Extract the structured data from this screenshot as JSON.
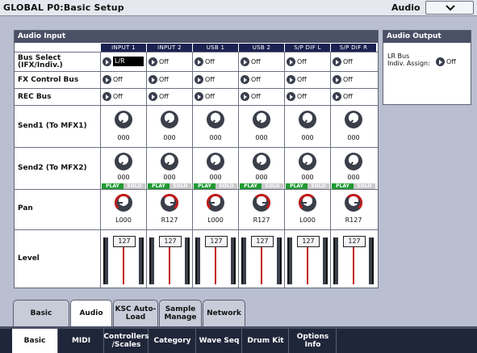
{
  "header": {
    "title": "GLOBAL P0:Basic Setup",
    "page": "Audio"
  },
  "audio_input": {
    "title": "Audio Input",
    "columns": [
      "INPUT 1",
      "INPUT 2",
      "USB 1",
      "USB 2",
      "S/P DIF L",
      "S/P DIF R"
    ],
    "rows": {
      "bus_select": {
        "label1": "Bus Select",
        "label2": "(IFX/Indiv.)",
        "values": [
          "L/R",
          "Off",
          "Off",
          "Off",
          "Off",
          "Off"
        ]
      },
      "fx_control": {
        "label": "FX Control Bus",
        "values": [
          "Off",
          "Off",
          "Off",
          "Off",
          "Off",
          "Off"
        ]
      },
      "rec_bus": {
        "label": "REC Bus",
        "values": [
          "Off",
          "Off",
          "Off",
          "Off",
          "Off",
          "Off"
        ]
      },
      "send1": {
        "label": "Send1 (To MFX1)",
        "values": [
          "000",
          "000",
          "000",
          "000",
          "000",
          "000"
        ]
      },
      "send2": {
        "label": "Send2 (To MFX2)",
        "values": [
          "000",
          "000",
          "000",
          "000",
          "000",
          "000"
        ]
      },
      "play_label": "PLAY",
      "solo_label": "SOLO",
      "pan": {
        "label": "Pan",
        "values": [
          "L000",
          "R127",
          "L000",
          "R127",
          "L000",
          "R127"
        ]
      },
      "level": {
        "label": "Level",
        "values": [
          "127",
          "127",
          "127",
          "127",
          "127",
          "127"
        ]
      }
    }
  },
  "audio_output": {
    "title": "Audio Output",
    "label1": "LR Bus",
    "label2": "Indiv. Assign:",
    "value": "Off"
  },
  "sub_tabs": [
    "Basic",
    "Audio",
    "KSC Auto-Load",
    "Sample Manage",
    "Network"
  ],
  "main_tabs": [
    "Basic",
    "MIDI",
    "Controllers /Scales",
    "Category",
    "Wave Seq",
    "Drum Kit",
    "Options Info"
  ]
}
